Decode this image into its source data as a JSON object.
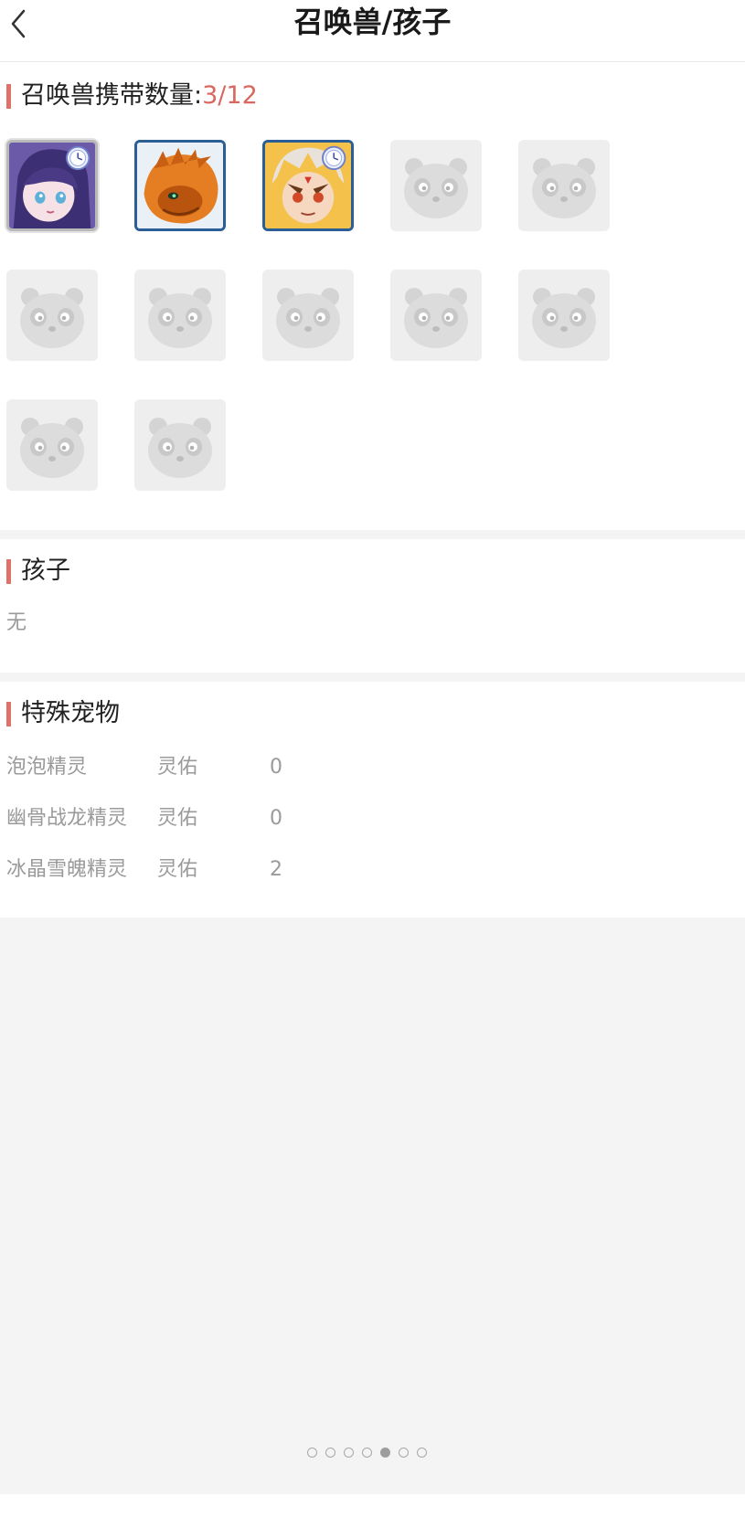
{
  "header": {
    "title": "召唤兽/孩子"
  },
  "pets": {
    "label": "召唤兽携带数量:",
    "count": "3/12",
    "slots": [
      {
        "state": "filled",
        "variant": "girl"
      },
      {
        "state": "filled",
        "variant": "beast"
      },
      {
        "state": "filled",
        "variant": "boy"
      },
      {
        "state": "empty"
      },
      {
        "state": "empty"
      },
      {
        "state": "empty"
      },
      {
        "state": "empty"
      },
      {
        "state": "empty"
      },
      {
        "state": "empty"
      },
      {
        "state": "empty"
      },
      {
        "state": "empty"
      },
      {
        "state": "empty"
      }
    ]
  },
  "children": {
    "title": "孩子",
    "empty_text": "无"
  },
  "special": {
    "title": "特殊宠物",
    "rows": [
      {
        "name": "泡泡精灵",
        "attr": "灵佑",
        "value": "0"
      },
      {
        "name": "幽骨战龙精灵",
        "attr": "灵佑",
        "value": "0"
      },
      {
        "name": "冰晶雪魄精灵",
        "attr": "灵佑",
        "value": "2"
      }
    ]
  },
  "pagination": {
    "total": 7,
    "active": 5
  },
  "icons": {
    "back": "chevron-left-icon",
    "placeholder": "panda-placeholder-icon",
    "clock": "clock-badge-icon"
  },
  "colors": {
    "accent": "#e0706a",
    "count": "#d9675f",
    "slot_border": "#2c5e96"
  }
}
